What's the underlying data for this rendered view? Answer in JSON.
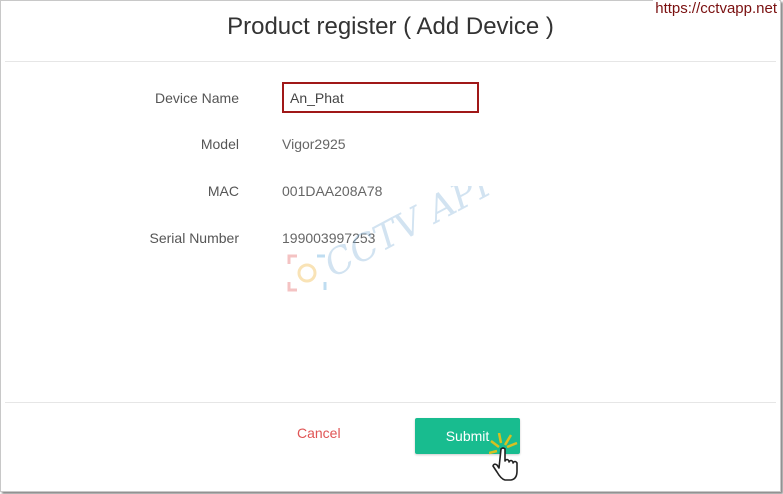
{
  "site_watermark": "https://cctvapp.net",
  "logo_watermark": "CCTV APP",
  "dialog": {
    "title": "Product register ( Add Device )"
  },
  "form": {
    "device_name_label": "Device Name",
    "device_name_value": "An_Phat",
    "model_label": "Model",
    "model_value": "Vigor2925",
    "mac_label": "MAC",
    "mac_value": "001DAA208A78",
    "serial_label": "Serial Number",
    "serial_value": "199003997253"
  },
  "actions": {
    "cancel_label": "Cancel",
    "submit_label": "Submit"
  },
  "colors": {
    "submit_bg": "#18bc8f",
    "cancel_text": "#e05555",
    "input_border": "#a01818"
  }
}
